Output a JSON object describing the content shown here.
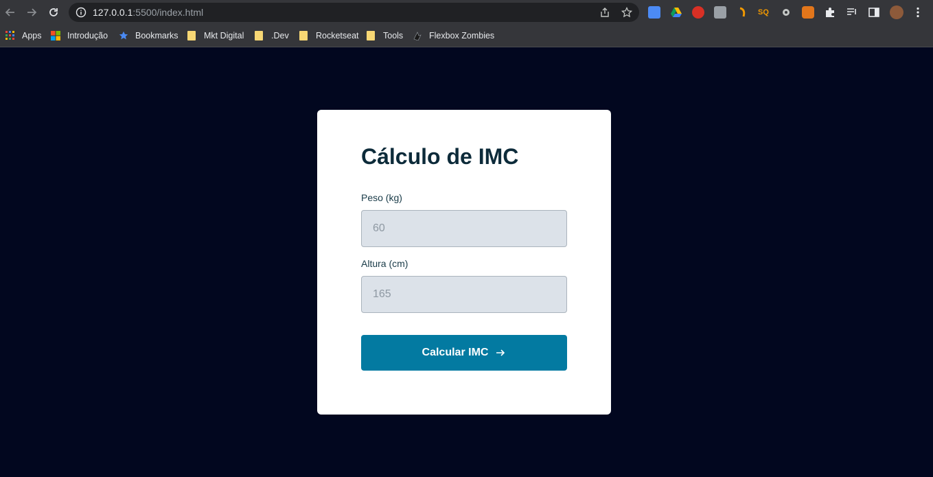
{
  "browser": {
    "url_host": "127.0.0.1",
    "url_rest": ":5500/index.html",
    "bookmarks": [
      {
        "label": "Apps",
        "icon": "apps-grid-icon"
      },
      {
        "label": "Introdução",
        "icon": "microsoft-icon"
      },
      {
        "label": "Bookmarks",
        "icon": "star-icon"
      },
      {
        "label": "Mkt Digital",
        "icon": "folder-icon"
      },
      {
        "label": ".Dev",
        "icon": "folder-icon"
      },
      {
        "label": "Rocketseat",
        "icon": "folder-icon"
      },
      {
        "label": "Tools",
        "icon": "folder-icon"
      },
      {
        "label": "Flexbox Zombies",
        "icon": "zombie-icon"
      }
    ]
  },
  "form": {
    "title": "Cálculo de IMC",
    "weight_label": "Peso (kg)",
    "weight_placeholder": "60",
    "height_label": "Altura (cm)",
    "height_placeholder": "165",
    "submit_label": "Calcular IMC"
  },
  "colors": {
    "page_bg": "#02071f",
    "card_bg": "#ffffff",
    "title": "#0d2b3a",
    "input_bg": "#dce2e9",
    "button_bg": "#037aa1"
  }
}
